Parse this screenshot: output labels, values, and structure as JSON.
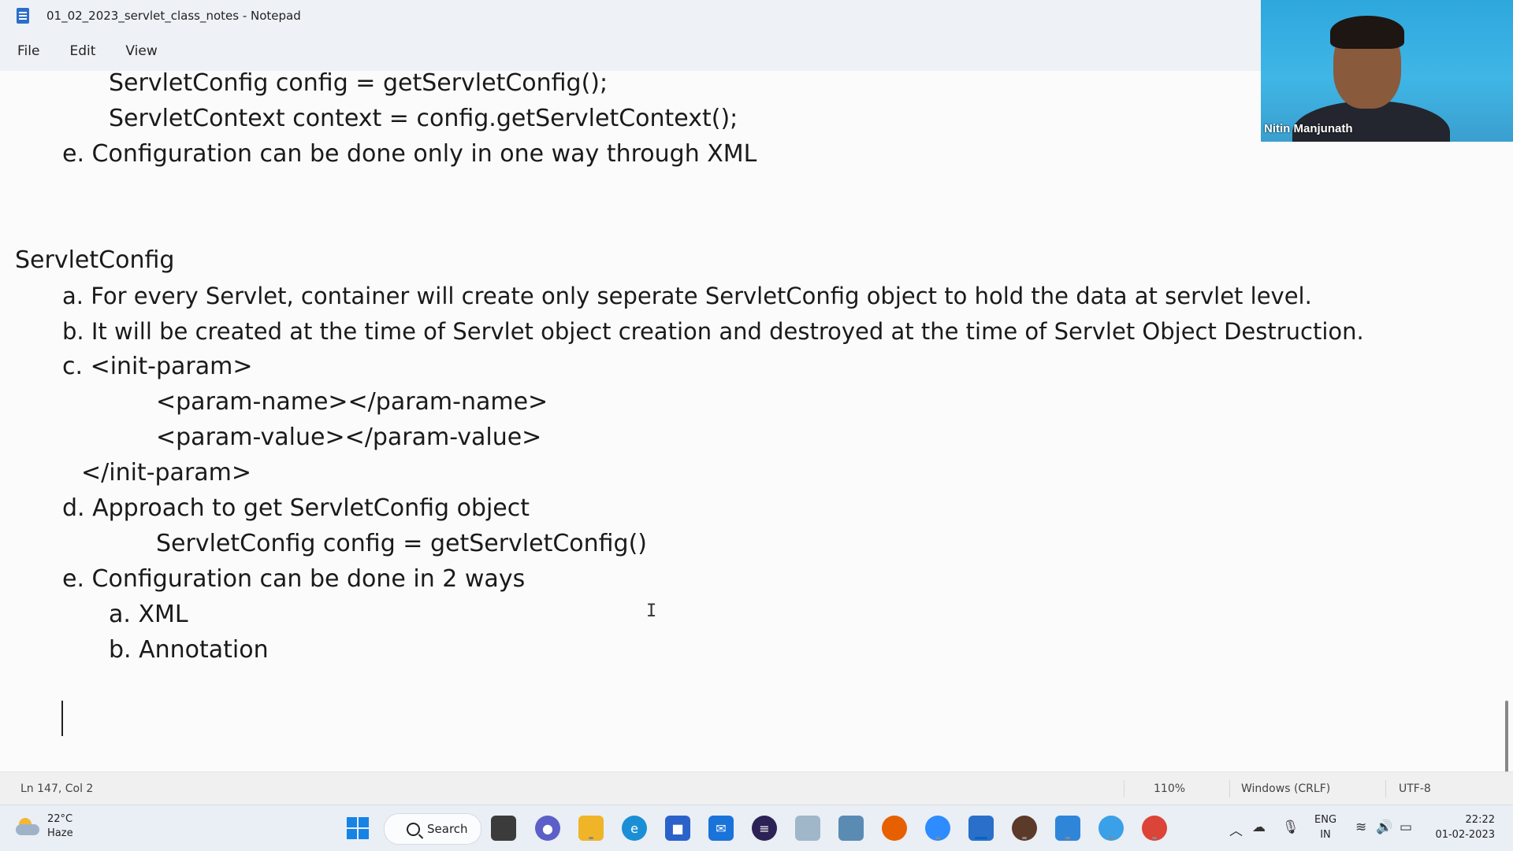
{
  "window": {
    "title": "01_02_2023_servlet_class_notes - Notepad"
  },
  "menu": {
    "file": "File",
    "edit": "Edit",
    "view": "View"
  },
  "editor": {
    "lines": [
      "ServletConfig config = getServletConfig();",
      "ServletContext context = config.getServletContext();",
      "e. Configuration can be done only in one way through XML",
      "ServletConfig",
      "a. For every Servlet, container will create only seperate ServletConfig object to hold the data at servlet level.",
      "b. It will be created at the time of Servlet object creation and destroyed at the time of Servlet Object Destruction.",
      "c. <init-param>",
      "<param-name></param-name>",
      "<param-value></param-value>",
      "</init-param>",
      "d. Approach to get ServletConfig object",
      "ServletConfig config = getServletConfig()",
      "e. Configuration can be done in 2 ways",
      "a. XML",
      "b. Annotation"
    ]
  },
  "video": {
    "participant_name": "Nitin Manjunath"
  },
  "status": {
    "position": "Ln 147, Col 2",
    "zoom": "110%",
    "line_ending": "Windows (CRLF)",
    "encoding": "UTF-8"
  },
  "taskbar": {
    "weather_temp": "22°C",
    "weather_desc": "Haze",
    "search_label": "Search",
    "lang_top": "ENG",
    "lang_bottom": "IN",
    "time": "22:22",
    "date": "01-02-2023",
    "apps": [
      "start",
      "search",
      "task-view",
      "chat",
      "file-explorer",
      "edge",
      "store",
      "mail",
      "eclipse",
      "app-6",
      "app-7",
      "firefox",
      "zoom",
      "notepad",
      "app-11",
      "app-12",
      "app-13",
      "chrome"
    ]
  },
  "colors": {
    "text": "#1a1a1a",
    "accent": "#0067c0",
    "background": "#fbfbfb"
  }
}
